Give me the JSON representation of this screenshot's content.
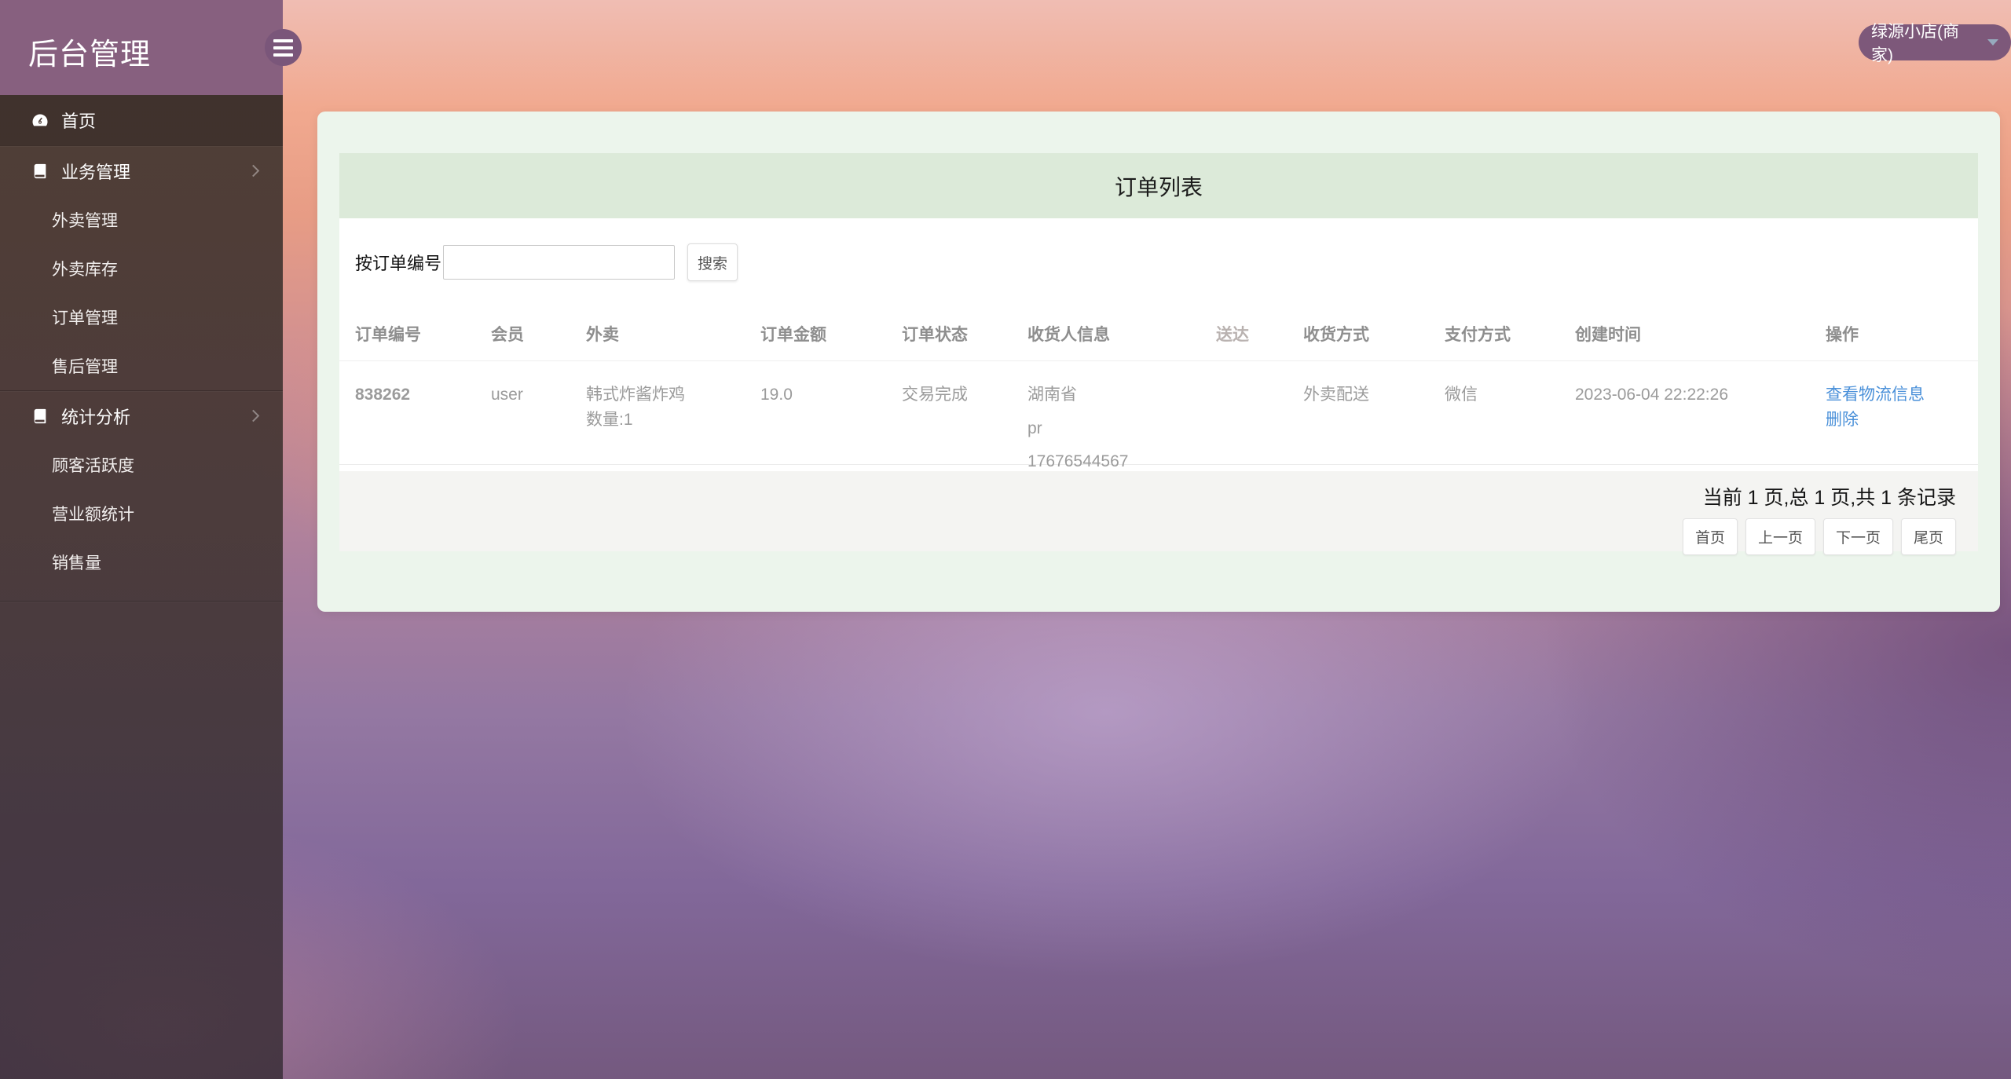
{
  "app": {
    "title": "后台管理"
  },
  "topbar": {
    "merchant_label": "绿源小店(商家)"
  },
  "sidebar": {
    "home": {
      "label": "首页"
    },
    "sections": [
      {
        "label": "业务管理",
        "items": [
          "外卖管理",
          "外卖库存",
          "订单管理",
          "售后管理"
        ]
      },
      {
        "label": "统计分析",
        "items": [
          "顾客活跃度",
          "营业额统计",
          "销售量"
        ]
      }
    ]
  },
  "panel": {
    "title": "订单列表",
    "search": {
      "label": "按订单编号",
      "value": "",
      "button": "搜索"
    },
    "table": {
      "headers": [
        "订单编号",
        "会员",
        "外卖",
        "订单金额",
        "订单状态",
        "收货人信息",
        "送达",
        "收货方式",
        "支付方式",
        "创建时间",
        "操作"
      ],
      "row": {
        "order_no": "838262",
        "member": "user",
        "takeout_name": "韩式炸酱炸鸡",
        "takeout_qty": "数量:1",
        "amount": "19.0",
        "status": "交易完成",
        "receiver_lines": [
          "湖南省",
          "pr",
          "17676544567"
        ],
        "delivered": "",
        "delivery_method": "外卖配送",
        "payment": "微信",
        "created_at": "2023-06-04 22:22:26",
        "actions": [
          "查看物流信息",
          "删除"
        ]
      }
    },
    "pagination": {
      "summary": "当前 1 页,总 1 页,共 1 条记录",
      "buttons": [
        "首页",
        "上一页",
        "下一页",
        "尾页"
      ]
    }
  },
  "colors": {
    "sidebar_header": "#87607f",
    "merchant_pill": "#7d587a",
    "card_green": "#ecf5ec",
    "band_green": "#dcead9",
    "accent_orange": "#f0a125",
    "link_blue": "#4a90d9"
  }
}
